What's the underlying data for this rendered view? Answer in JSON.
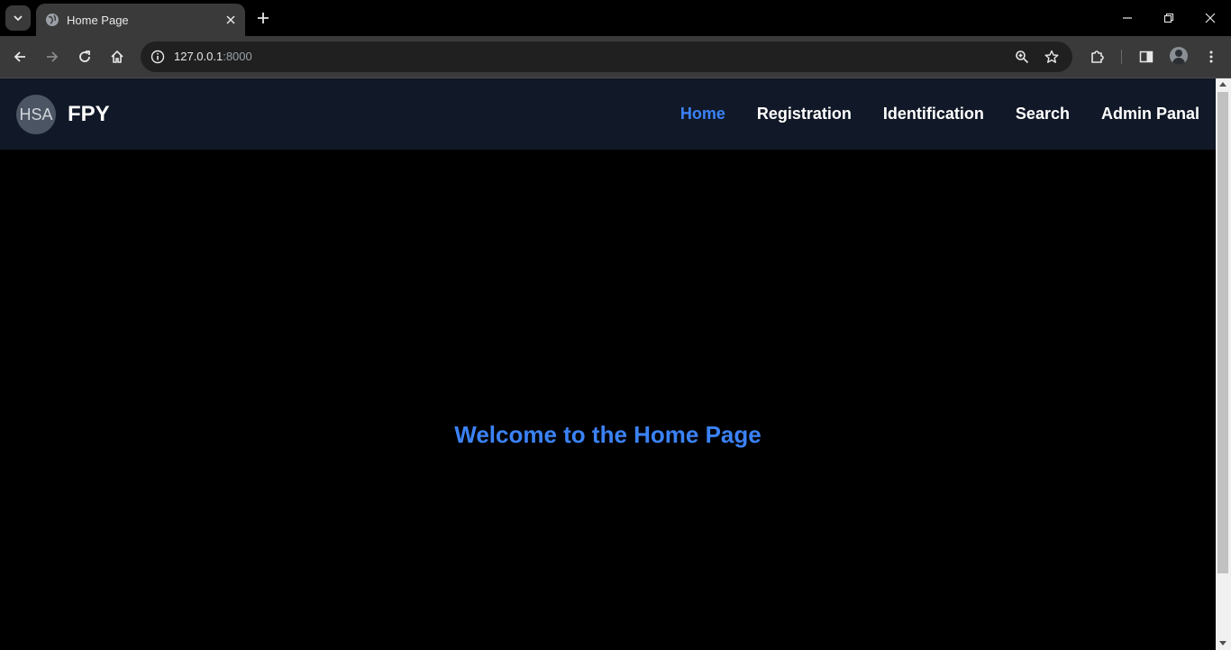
{
  "browser": {
    "tab_title": "Home Page",
    "url_host": "127.0.0.1",
    "url_port": ":8000",
    "icons": {
      "tab_search": "chevron-down-icon",
      "favicon": "globe-icon",
      "tab_close": "close-icon",
      "new_tab": "plus-icon",
      "minimize": "minimize-icon",
      "restore": "restore-icon",
      "close_window": "close-icon",
      "back": "back-arrow-icon",
      "forward": "forward-arrow-icon",
      "reload": "reload-icon",
      "home": "home-icon",
      "site_info": "info-icon",
      "zoom": "zoom-icon",
      "bookmark": "star-icon",
      "extensions": "puzzle-icon",
      "side_panel": "side-panel-icon",
      "profile": "profile-avatar-icon",
      "menu": "kebab-menu-icon"
    }
  },
  "site": {
    "logo_text": "HSA",
    "brand": "FPY",
    "nav": [
      {
        "label": "Home",
        "active": true
      },
      {
        "label": "Registration",
        "active": false
      },
      {
        "label": "Identification",
        "active": false
      },
      {
        "label": "Search",
        "active": false
      },
      {
        "label": "Admin Panal",
        "active": false
      }
    ],
    "welcome": "Welcome to the Home Page"
  },
  "colors": {
    "navbar_bg": "#111827",
    "accent": "#3b82f6",
    "page_bg": "#000000"
  }
}
